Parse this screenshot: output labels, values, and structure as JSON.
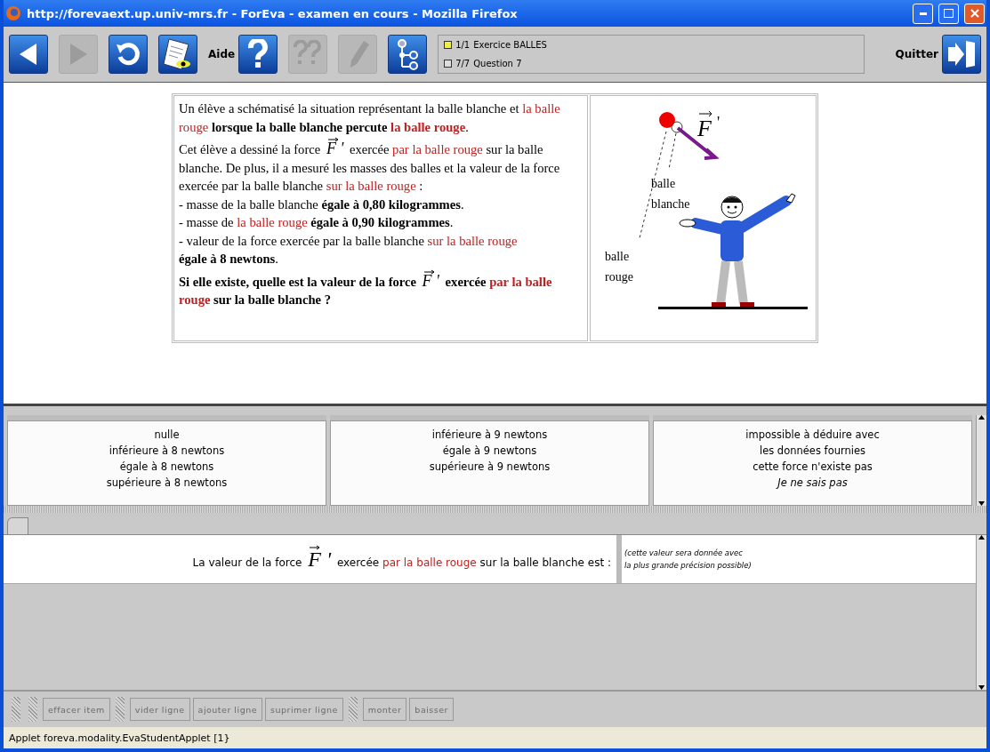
{
  "window": {
    "title": "http://forevaext.up.univ-mrs.fr - ForEva - examen en cours - Mozilla Firefox"
  },
  "toolbar": {
    "buttons": [
      {
        "kind": "back",
        "disabled": false
      },
      {
        "kind": "forward",
        "disabled": true
      },
      {
        "kind": "reload",
        "disabled": false
      },
      {
        "kind": "document",
        "disabled": false
      },
      {
        "kind": "label",
        "text": "Aide"
      },
      {
        "kind": "help",
        "disabled": false
      },
      {
        "kind": "hint",
        "disabled": true
      },
      {
        "kind": "pencil",
        "disabled": true
      },
      {
        "kind": "tree",
        "disabled": false
      }
    ],
    "info": [
      {
        "count": "1/1",
        "text": "Exercice BALLES"
      },
      {
        "count": "7/7",
        "text": "Question 7"
      }
    ],
    "quit": {
      "label": "Quitter"
    }
  },
  "question": {
    "paragraphs": [
      [
        {
          "text": "Un élève a schématisé la situation représentant la balle blanche et "
        },
        {
          "text": "la balle rouge",
          "red": true
        },
        {
          "text": " lorsque la balle blanche percute ",
          "bold": true
        },
        {
          "text": "la balle rouge",
          "red": true,
          "bold": true
        },
        {
          "text": "."
        }
      ],
      [
        {
          "text": "Cet élève a dessiné la force "
        },
        {
          "kind": "vector",
          "text": "F",
          "prime": "'"
        },
        {
          "text": " exercée "
        },
        {
          "text": "par la balle rouge",
          "red": true
        },
        {
          "text": " sur la balle blanche. De plus, il a mesuré les masses des balles et la valeur de la force exercée par la balle blanche "
        },
        {
          "text": "sur la balle rouge",
          "red": true
        },
        {
          "text": " :"
        },
        {
          "kind": "break"
        },
        {
          "text": "- masse de la balle blanche "
        },
        {
          "text": "égale à 0,80 kilogrammes",
          "bold": true
        },
        {
          "text": "."
        },
        {
          "kind": "break"
        },
        {
          "text": "- masse de "
        },
        {
          "text": "la balle rouge",
          "red": true
        },
        {
          "text": " égale à 0,90 kilogrammes",
          "bold": true
        },
        {
          "text": "."
        },
        {
          "kind": "break"
        },
        {
          "text": "- valeur de la force exercée par la balle blanche "
        },
        {
          "text": "sur la balle rouge",
          "red": true
        },
        {
          "kind": "break"
        },
        {
          "text": "égale à 8 newtons",
          "bold": true
        },
        {
          "text": "."
        }
      ],
      [
        {
          "text": "Si elle existe, quelle est la valeur de la force ",
          "bold": true
        },
        {
          "kind": "vector",
          "text": "F",
          "prime": "'"
        },
        {
          "text": " exercée ",
          "bold": true
        },
        {
          "text": "par la balle rouge",
          "red": true,
          "bold": true
        },
        {
          "text": " sur la balle blanche ?",
          "bold": true
        }
      ]
    ],
    "figure": {
      "vector": "F",
      "prime": "'",
      "white_label": [
        "balle",
        "blanche"
      ],
      "red_label": [
        "balle",
        "rouge"
      ]
    }
  },
  "choices": [
    [
      {
        "text": "nulle",
        "kind": "answer"
      },
      {
        "text": "inférieure à 8 newtons",
        "kind": "answer"
      },
      {
        "text": "égale à 8 newtons",
        "kind": "answer"
      },
      {
        "text": "supérieure à 8 newtons",
        "kind": "answer"
      }
    ],
    [
      {
        "text": "inférieure à 9 newtons",
        "kind": "answer"
      },
      {
        "text": "égale à 9 newtons",
        "kind": "answer"
      },
      {
        "text": "supérieure à 9 newtons",
        "kind": "answer"
      }
    ],
    [
      {
        "text": "impossible à déduire avec",
        "kind": "answer"
      },
      {
        "text": "les données fournies",
        "kind": "answer"
      },
      {
        "text": "cette force n'existe pas",
        "kind": "answer"
      },
      {
        "text": "Je ne sais pas",
        "kind": "dontknow"
      }
    ]
  ],
  "response": {
    "sentence": [
      {
        "text": "La valeur de la force "
      },
      {
        "kind": "vector",
        "text": "F",
        "prime": "'"
      },
      {
        "text": " exercée "
      },
      {
        "text": "par la balle rouge",
        "red": true
      },
      {
        "text": " sur la balle blanche est :"
      }
    ],
    "hint": [
      "(cette valeur sera donnée avec",
      "la plus grande précision possible)"
    ]
  },
  "edit_buttons": [
    [
      {
        "label": "effacer item",
        "disabled": true
      }
    ],
    [
      {
        "label": "vider ligne",
        "disabled": true
      },
      {
        "label": "ajouter ligne",
        "disabled": true
      },
      {
        "label": "suprimer ligne",
        "disabled": true
      }
    ],
    [
      {
        "label": "monter",
        "disabled": true
      },
      {
        "label": "baisser",
        "disabled": true
      }
    ]
  ],
  "status_bar": "Applet foreva.modality.EvaStudentApplet [1}"
}
